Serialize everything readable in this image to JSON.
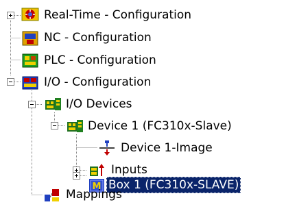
{
  "tree": {
    "items": [
      {
        "label": "Real-Time - Configuration",
        "icon": "realtime-config-icon",
        "expanded": false,
        "has_children": true
      },
      {
        "label": "NC - Configuration",
        "icon": "nc-config-icon",
        "has_children": false
      },
      {
        "label": "PLC - Configuration",
        "icon": "plc-config-icon",
        "has_children": false
      },
      {
        "label": "I/O - Configuration",
        "icon": "io-config-icon",
        "expanded": true,
        "has_children": true
      },
      {
        "label": "I/O Devices",
        "icon": "io-devices-icon",
        "expanded": true,
        "has_children": true
      },
      {
        "label": "Device 1 (FC310x-Slave)",
        "icon": "device-card-icon",
        "expanded": true,
        "has_children": true
      },
      {
        "label": "Device 1-Image",
        "icon": "process-image-icon",
        "has_children": false
      },
      {
        "label": "Inputs",
        "icon": "inputs-icon",
        "expanded": false,
        "has_children": true
      },
      {
        "label": "Box 1 (FC310x-SLAVE)",
        "icon": "box-module-icon",
        "expanded": false,
        "has_children": true,
        "selected": true
      },
      {
        "label": "Mappings",
        "icon": "mappings-icon",
        "has_children": false
      }
    ]
  },
  "colors": {
    "selection_background": "#0a246a",
    "selection_text": "#ffffff",
    "tree_lines": "#808080"
  }
}
